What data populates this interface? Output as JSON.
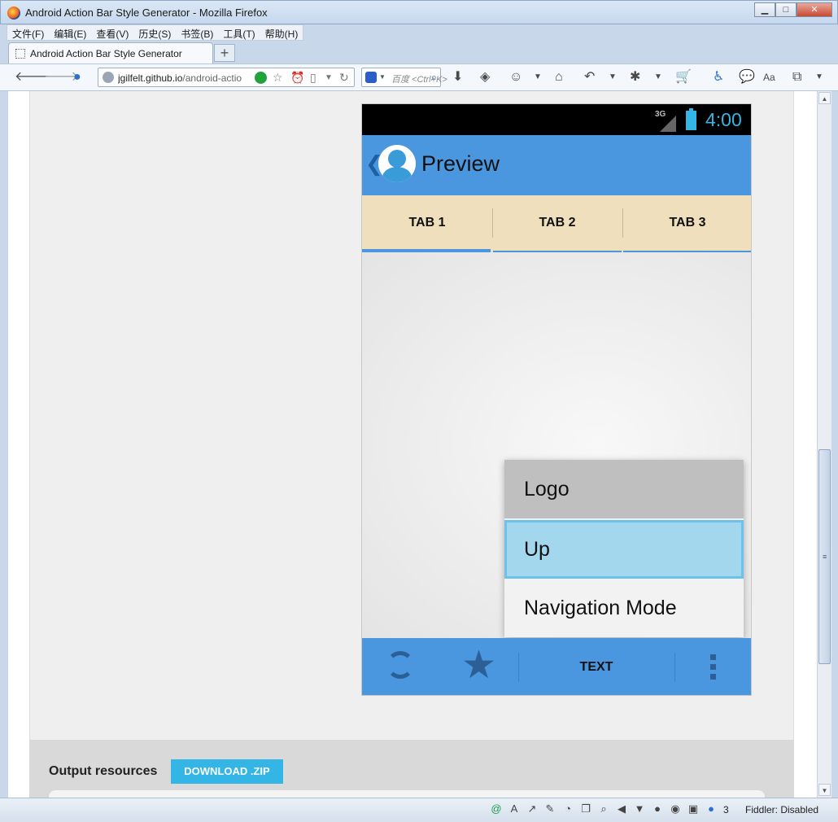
{
  "window": {
    "title": "Android Action Bar Style Generator - Mozilla Firefox",
    "minimize": "▁",
    "maximize": "□",
    "close": "✕"
  },
  "menubar": {
    "items": [
      "文件(F)",
      "编辑(E)",
      "查看(V)",
      "历史(S)",
      "书签(B)",
      "工具(T)",
      "帮助(H)"
    ]
  },
  "browser": {
    "tab_title": "Android Action Bar Style Generator",
    "new_tab": "+",
    "url_host": "jgilfelt.github.io",
    "url_rest": "/android-actio",
    "search_placeholder": "百度 <Ctrl+K>"
  },
  "phone": {
    "status": {
      "network": "3G",
      "time": "4:00"
    },
    "action_bar": {
      "title": "Preview",
      "up_indicator": "❮"
    },
    "tabs": [
      {
        "label": "TAB 1",
        "selected": true
      },
      {
        "label": "TAB 2",
        "selected": false
      },
      {
        "label": "TAB 3",
        "selected": false
      }
    ],
    "overflow_menu": {
      "items": [
        {
          "label": "Logo",
          "state": "pressed"
        },
        {
          "label": "Up",
          "state": "focused"
        },
        {
          "label": "Navigation Mode",
          "state": "normal"
        }
      ]
    },
    "bottom_bar": {
      "icons": [
        "refresh-icon",
        "star-icon",
        "overflow-icon"
      ],
      "text_action": "TEXT"
    },
    "colors": {
      "action_bar": "#4a97e0",
      "tab_bar": "#efdfbd",
      "tab_indicator": "#4a97e0",
      "status_accent": "#33b5e5",
      "menu_pressed": "#bfbfbf",
      "menu_focused": "#a3d7ee"
    }
  },
  "output": {
    "title": "Output resources",
    "download_label": "DOWNLOAD .ZIP"
  },
  "addonbar": {
    "count": "3",
    "fiddler": "Fiddler: Disabled"
  }
}
